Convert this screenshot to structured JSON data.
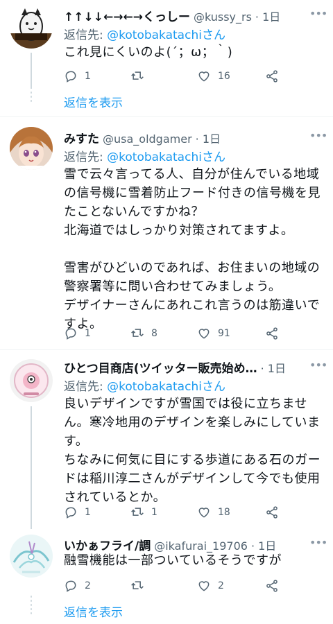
{
  "tweets": [
    {
      "name": "↑↑↓↓←→←→くっしー",
      "handle": "@kussy_rs",
      "time": "· 1日",
      "reply_prefix": "返信先: ",
      "reply_mention": "@kotobakatachiさん",
      "body": "これ見にくいのよ(´；ω；｀)",
      "replies": "1",
      "retweets": "",
      "likes": "16",
      "show_replies": "返信を表示",
      "avatar_icon": "cat-avatar-icon"
    },
    {
      "name": "みすた",
      "handle": "@usa_oldgamer",
      "time": "· 1日",
      "reply_prefix": "返信先: ",
      "reply_mention": "@kotobakatachiさん",
      "body": "雪で云々言ってる人、自分が住んでいる地域の信号機に雪着防止フード付きの信号機を見たことないんですかね？\n北海道ではしっかり対策されてますよ。\n\n雪害がひどいのであれば、お住まいの地域の警察署等に問い合わせてみましょう。\nデザイナーさんにあれこれ言うのは筋違いですよ。",
      "replies": "1",
      "retweets": "8",
      "likes": "91",
      "avatar_icon": "anime-girl-avatar-icon"
    },
    {
      "name": "ひとつ目商店(ツイッター販売始め…",
      "handle": "",
      "time": "· 1日",
      "reply_prefix": "返信先: ",
      "reply_mention": "@kotobakatachiさん",
      "body": "良いデザインですが雪国では役に立ちません。寒冷地用のデザインを楽しみにしています。\nちなみに何気に目にする歩道にある石のガードは稲川淳二さんがデザインして今でも使用されているとか。",
      "replies": "1",
      "retweets": "1",
      "likes": "18",
      "avatar_icon": "shop-logo-avatar-icon"
    },
    {
      "name": "いかぁフライ/調",
      "handle": "@ikafurai_19706",
      "time": "· 1日",
      "body": "融雪機能は一部ついているそうですが",
      "replies": "2",
      "retweets": "",
      "likes": "2",
      "show_replies": "返信を表示",
      "avatar_icon": "drawing-avatar-icon"
    }
  ],
  "colors": {
    "accent": "#1d9bf0",
    "muted": "#536471",
    "text": "#0f1419",
    "line": "#cfd9de"
  }
}
